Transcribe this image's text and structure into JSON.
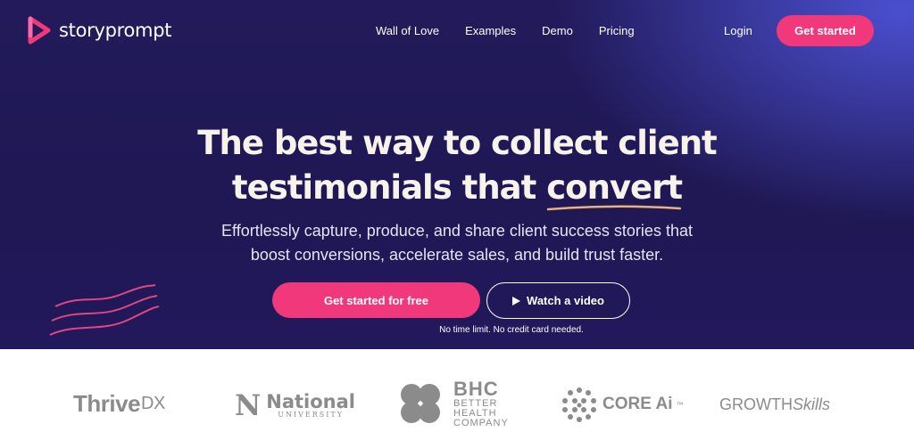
{
  "brand": {
    "name": "storyprompt",
    "logo_icon": "storyprompt-play-logo-icon",
    "accent_color": "#f0387a"
  },
  "nav": {
    "links": [
      "Wall of Love",
      "Examples",
      "Demo",
      "Pricing"
    ],
    "login": "Login",
    "cta": "Get started"
  },
  "hero": {
    "headline_line1": "The best way to collect client",
    "headline_line2_prefix": "testimonials that ",
    "headline_accent": "convert",
    "subheadline_line1": "Effortlessly capture, produce, and share client success stories that",
    "subheadline_line2": "boost conversions, accelerate sales, and build trust faster.",
    "primary_button": "Get started for free",
    "secondary_button": "Watch a video",
    "secondary_button_icon": "play-icon",
    "note": "No time limit. No credit card needed."
  },
  "logos": {
    "thrive_main": "Thrive",
    "thrive_suffix": "DX",
    "national_mark": "N",
    "national_name": "National",
    "national_sub": "UNIVERSITY",
    "bhc_main": "BHC",
    "bhc_line1": "BETTER",
    "bhc_line2": "HEALTH",
    "bhc_line3": "COMPANY",
    "core": "CORE Ai",
    "core_tm": "™",
    "growth_main": "GROWTH",
    "growth_italic": "Skills"
  }
}
